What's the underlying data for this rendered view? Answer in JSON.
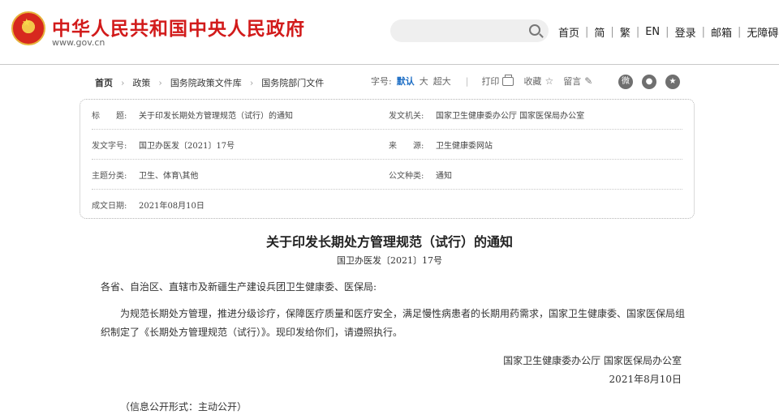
{
  "header": {
    "site_title": "中华人民共和国中央人民政府",
    "site_url": "www.gov.cn",
    "search": {
      "placeholder": ""
    },
    "nav": [
      "首页",
      "简",
      "繁",
      "EN",
      "登录",
      "邮箱",
      "无障碍"
    ]
  },
  "breadcrumb": [
    "首页",
    "政策",
    "国务院政策文件库",
    "国务院部门文件"
  ],
  "tools": {
    "font_size_label": "字号:",
    "font_sizes": [
      "默认",
      "大",
      "超大"
    ],
    "active_font_size": "默认",
    "print_label": "打印",
    "favorite_label": "收藏",
    "comment_label": "留言",
    "share": [
      "weibo-icon",
      "wechat-icon",
      "qzone-icon"
    ]
  },
  "meta": {
    "title_key": "标　　题:",
    "title_val": "关于印发长期处方管理规范（试行）的通知",
    "issuer_key": "发文机关:",
    "issuer_val": "国家卫生健康委办公厅 国家医保局办公室",
    "docno_key": "发文字号:",
    "docno_val": "国卫办医发〔2021〕17号",
    "source_key": "来　　源:",
    "source_val": "卫生健康委网站",
    "topic_key": "主题分类:",
    "topic_val": "卫生、体育\\其他",
    "type_key": "公文种类:",
    "type_val": "通知",
    "date_key": "成文日期:",
    "date_val": "2021年08月10日"
  },
  "article": {
    "title": "关于印发长期处方管理规范（试行）的通知",
    "doc_no": "国卫办医发〔2021〕17号",
    "addressee": "各省、自治区、直辖市及新疆生产建设兵团卫生健康委、医保局:",
    "body": "为规范长期处方管理，推进分级诊疗，保障医疗质量和医疗安全，满足慢性病患者的长期用药需求，国家卫生健康委、国家医保局组织制定了《长期处方管理规范（试行）》。现印发给你们，请遵照执行。",
    "signer": "国家卫生健康委办公厅 国家医保局办公室",
    "sign_date": "2021年8月10日",
    "disclosure": "（信息公开形式：主动公开）"
  },
  "colors": {
    "brand_red": "#d21b1b",
    "active_blue": "#1d6ec5"
  }
}
